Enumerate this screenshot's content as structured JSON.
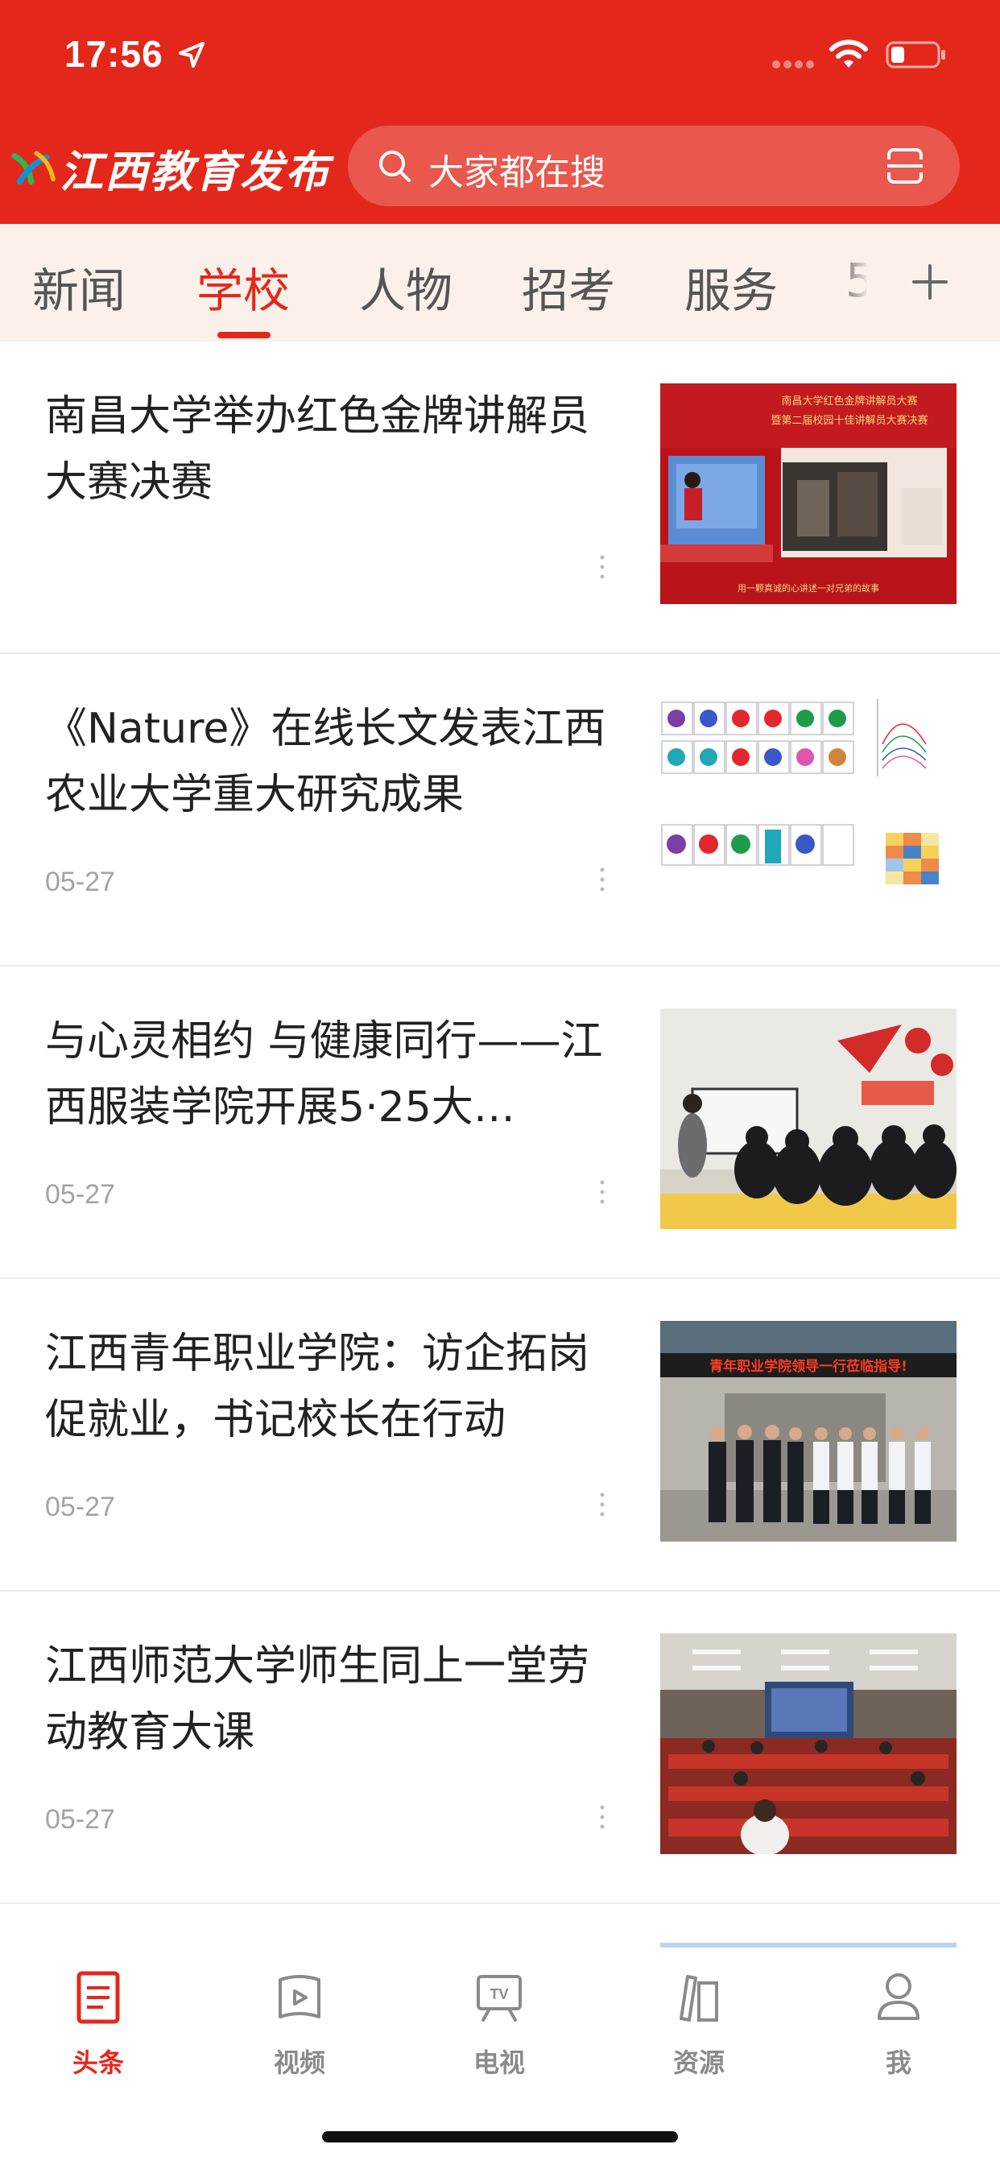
{
  "status": {
    "time": "17:56"
  },
  "header": {
    "logo_text": "江西教育发布",
    "search_placeholder": "大家都在搜"
  },
  "tabs": [
    {
      "label": "新闻"
    },
    {
      "label": "学校",
      "active": true
    },
    {
      "label": "人物"
    },
    {
      "label": "招考"
    },
    {
      "label": "服务"
    },
    {
      "label": "5"
    }
  ],
  "articles": [
    {
      "title": "南昌大学举办红色金牌讲解员大赛决赛",
      "date": ""
    },
    {
      "title": "《Nature》在线长文发表江西农业大学重大研究成果",
      "date": "05-27"
    },
    {
      "title": "与心灵相约 与健康同行——江西服装学院开展5·25大…",
      "date": "05-27"
    },
    {
      "title": "江西青年职业学院：访企拓岗促就业，书记校长在行动",
      "date": "05-27"
    },
    {
      "title": "江西师范大学师生同上一堂劳动教育大课",
      "date": "05-27"
    }
  ],
  "thumb1": {
    "line1": "南昌大学红色金牌讲解员大赛",
    "line2": "暨第二届校园十佳讲解员大赛决赛",
    "caption": "用一颗真诚的心讲述一对兄弟的故事"
  },
  "thumb4": {
    "banner": "青年职业学院领导一行莅临指导!"
  },
  "bottom_nav": [
    {
      "label": "头条",
      "icon": "headline-icon",
      "active": true
    },
    {
      "label": "视频",
      "icon": "video-icon"
    },
    {
      "label": "电视",
      "icon": "tv-icon"
    },
    {
      "label": "资源",
      "icon": "resource-icon"
    },
    {
      "label": "我",
      "icon": "profile-icon"
    }
  ],
  "colors": {
    "brand_red": "#e3281b",
    "tab_bg": "#fbf1ea",
    "inactive": "#8a8a8a"
  }
}
